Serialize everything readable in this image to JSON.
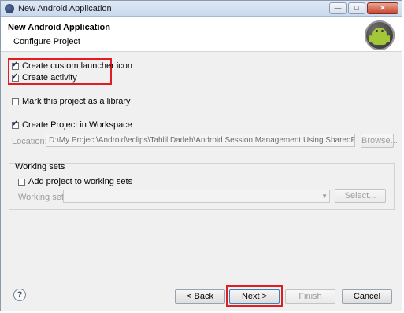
{
  "window": {
    "title": "New Android Application",
    "controls": {
      "minimize": "—",
      "maximize": "□",
      "close": "✕"
    }
  },
  "header": {
    "title": "New Android Application",
    "subtitle": "Configure Project",
    "logo_icon": "android-logo-icon"
  },
  "options": {
    "create_launcher_icon": {
      "label": "Create custom launcher icon",
      "checked": true
    },
    "create_activity": {
      "label": "Create activity",
      "checked": true
    },
    "mark_library": {
      "label": "Mark this project as a library",
      "checked": false
    },
    "create_in_workspace": {
      "label": "Create Project in Workspace",
      "checked": true
    }
  },
  "location": {
    "label": "Location:",
    "value": "D:\\My Project\\Android\\eclips\\Tahlil Dadeh\\Android Session Management Using SharedPreferences\\",
    "browse_label": "Browse..."
  },
  "working_sets": {
    "group_label": "Working sets",
    "add_label": "Add project to working sets",
    "add_checked": false,
    "sets_label": "Working sets:",
    "sets_value": "",
    "select_label": "Select..."
  },
  "footer": {
    "back_label": "< Back",
    "next_label": "Next >",
    "finish_label": "Finish",
    "cancel_label": "Cancel",
    "help_icon": "help-icon"
  },
  "highlight_color": "#e31b23"
}
